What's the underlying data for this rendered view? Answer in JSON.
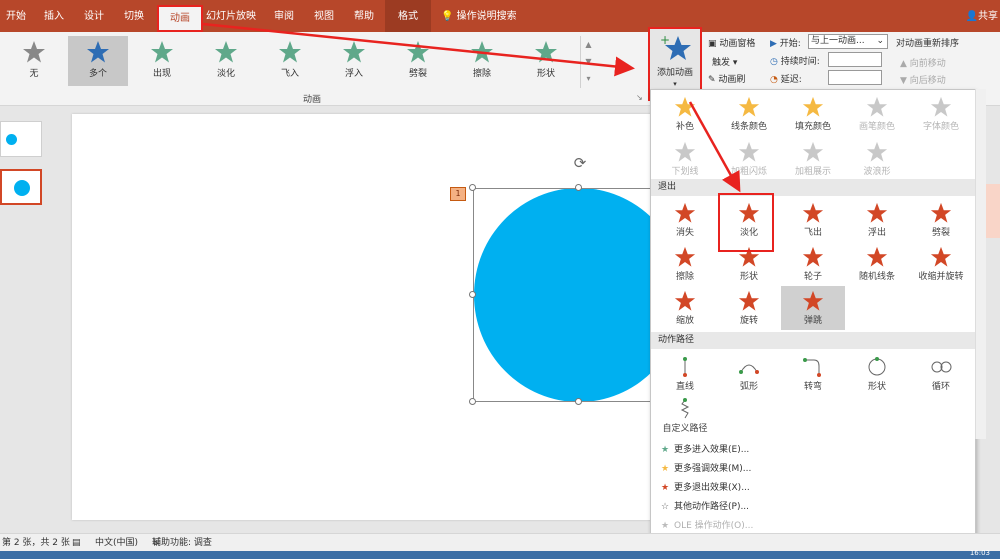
{
  "tabs": [
    "开始",
    "插入",
    "设计",
    "切换",
    "动画",
    "幻灯片放映",
    "审阅",
    "视图",
    "帮助",
    "格式"
  ],
  "active_tab": "动画",
  "tell_me": "操作说明搜索",
  "share": "共享",
  "gallery_items": [
    "无",
    "多个",
    "出现",
    "淡化",
    "飞入",
    "浮入",
    "劈裂",
    "擦除",
    "形状"
  ],
  "gallery_group_label": "动画",
  "add_animation": {
    "label": "添加动画"
  },
  "advanced": {
    "pane": "动画窗格",
    "trigger": "触发",
    "painter": "动画刷"
  },
  "timing": {
    "start_label": "开始:",
    "start_value": "与上一动画...",
    "duration_label": "持续时间:",
    "delay_label": "延迟:"
  },
  "reorder": {
    "title": "对动画重新排序",
    "earlier": "向前移动",
    "later": "向后移动"
  },
  "slide": {
    "anim_tag": "1"
  },
  "dropdown": {
    "emphasis_row1": [
      "补色",
      "线条颜色",
      "填充颜色",
      "画笔颜色",
      "字体颜色"
    ],
    "emphasis_row2": [
      "下划线",
      "加粗闪烁",
      "加粗展示",
      "波浪形"
    ],
    "exit_header": "退出",
    "exit_row1": [
      "消失",
      "淡化",
      "飞出",
      "浮出",
      "劈裂"
    ],
    "exit_row2": [
      "擦除",
      "形状",
      "轮子",
      "随机线条",
      "收缩并旋转"
    ],
    "exit_row3": [
      "缩放",
      "旋转",
      "弹跳"
    ],
    "path_header": "动作路径",
    "path_row1": [
      "直线",
      "弧形",
      "转弯",
      "形状",
      "循环"
    ],
    "path_row2": [
      "自定义路径"
    ],
    "menu": [
      "更多进入效果(E)...",
      "更多强调效果(M)...",
      "更多退出效果(X)...",
      "其他动作路径(P)...",
      "OLE 操作动作(O)..."
    ]
  },
  "status": {
    "slide_info": "第 2 张，共 2 张",
    "language": "中文(中国)",
    "accessibility": "辅助功能: 调查"
  },
  "clock": "16:03",
  "colors": {
    "ribbon": "#b7472a",
    "circle": "#00b0f0",
    "highlight_red": "#e8231f",
    "exit_star": "#d24726",
    "entrance_star": "#5fa88a",
    "emphasis_star": "#f5b942"
  }
}
